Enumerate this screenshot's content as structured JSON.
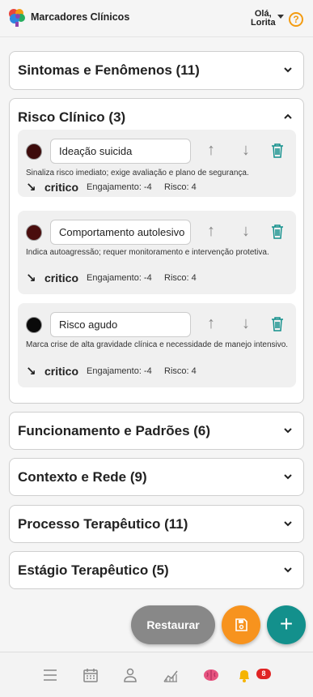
{
  "header": {
    "app_title": "Marcadores Clínicos",
    "greeting_line1": "Olá,",
    "greeting_line2": "Lorita",
    "help_label": "?"
  },
  "sections": [
    {
      "title": "Sintomas e Fenômenos (11)",
      "expanded": false
    },
    {
      "title": "Risco Clínico (3)",
      "expanded": true
    },
    {
      "title": "Funcionamento e Padrões (6)",
      "expanded": false
    },
    {
      "title": "Contexto e Rede (9)",
      "expanded": false
    },
    {
      "title": "Processo Terapêutico (11)",
      "expanded": false
    },
    {
      "title": "Estágio Terapêutico (5)",
      "expanded": false
    }
  ],
  "risk_markers": [
    {
      "name": "Ideação suicida",
      "color": "#3d0b0b",
      "description": "Sinaliza risco imediato; exige avaliação e plano de segurança.",
      "trend": "↘",
      "level": "critico",
      "engagement": "Engajamento: -4",
      "risk": "Risco: 4"
    },
    {
      "name": "Comportamento autolesivo",
      "color": "#4a0d0d",
      "description": "Indica autoagressão; requer monitoramento e intervenção protetiva.",
      "trend": "↘",
      "level": "critico",
      "engagement": "Engajamento: -4",
      "risk": "Risco: 4"
    },
    {
      "name": "Risco agudo",
      "color": "#0a0a0a",
      "description": "Marca crise de alta gravidade clínica e necessidade de manejo intensivo.",
      "trend": "↘",
      "level": "critico",
      "engagement": "Engajamento: -4",
      "risk": "Risco: 4"
    }
  ],
  "actions": {
    "restore_label": "Restaurar",
    "add_label": "+"
  },
  "nav": {
    "notification_count": "8"
  },
  "colors": {
    "accent_teal": "#13908c",
    "accent_orange": "#f7931e",
    "badge_red": "#e02424"
  }
}
